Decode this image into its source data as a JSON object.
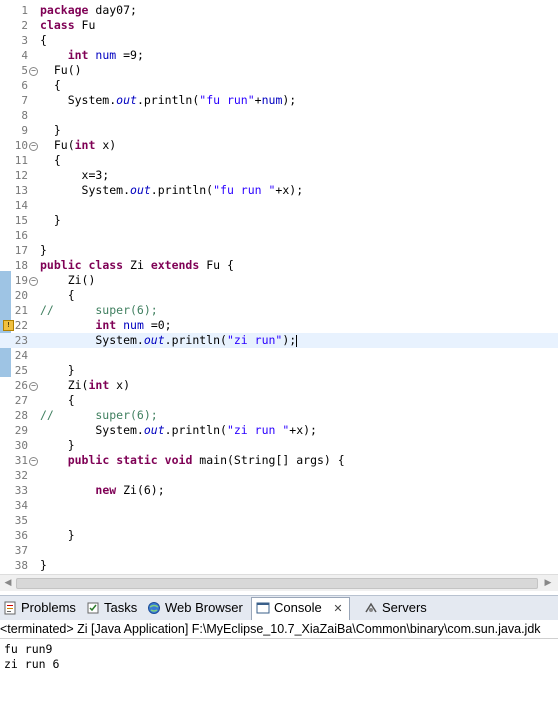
{
  "editor": {
    "current_line": 23,
    "lines": [
      {
        "n": "1",
        "segs": [
          {
            "t": "package",
            "c": "kw"
          },
          {
            "t": " day07;"
          }
        ]
      },
      {
        "n": "2",
        "segs": [
          {
            "t": "class",
            "c": "kw"
          },
          {
            "t": " Fu"
          }
        ]
      },
      {
        "n": "3",
        "segs": [
          {
            "t": "{"
          }
        ]
      },
      {
        "n": "4",
        "segs": [
          {
            "t": "    "
          },
          {
            "t": "int",
            "c": "kw"
          },
          {
            "t": " "
          },
          {
            "t": "num",
            "c": "fld"
          },
          {
            "t": " =9;"
          }
        ]
      },
      {
        "n": "5",
        "fold": true,
        "segs": [
          {
            "t": "  Fu()"
          }
        ]
      },
      {
        "n": "6",
        "segs": [
          {
            "t": "  {"
          }
        ]
      },
      {
        "n": "7",
        "segs": [
          {
            "t": "    System."
          },
          {
            "t": "out",
            "c": "it"
          },
          {
            "t": ".println("
          },
          {
            "t": "\"fu run\"",
            "c": "str"
          },
          {
            "t": "+"
          },
          {
            "t": "num",
            "c": "fld"
          },
          {
            "t": ");"
          }
        ]
      },
      {
        "n": "8",
        "segs": []
      },
      {
        "n": "9",
        "segs": [
          {
            "t": "  }"
          }
        ]
      },
      {
        "n": "10",
        "fold": true,
        "segs": [
          {
            "t": "  Fu("
          },
          {
            "t": "int",
            "c": "kw"
          },
          {
            "t": " x)"
          }
        ]
      },
      {
        "n": "11",
        "segs": [
          {
            "t": "  {"
          }
        ]
      },
      {
        "n": "12",
        "segs": [
          {
            "t": "      x=3;"
          }
        ]
      },
      {
        "n": "13",
        "segs": [
          {
            "t": "      System."
          },
          {
            "t": "out",
            "c": "it"
          },
          {
            "t": ".println("
          },
          {
            "t": "\"fu run \"",
            "c": "str"
          },
          {
            "t": "+x);"
          }
        ]
      },
      {
        "n": "14",
        "segs": []
      },
      {
        "n": "15",
        "segs": [
          {
            "t": "  }"
          }
        ]
      },
      {
        "n": "16",
        "segs": []
      },
      {
        "n": "17",
        "segs": [
          {
            "t": "}"
          }
        ]
      },
      {
        "n": "18",
        "segs": [
          {
            "t": "public",
            "c": "kw"
          },
          {
            "t": " "
          },
          {
            "t": "class",
            "c": "kw"
          },
          {
            "t": " Zi "
          },
          {
            "t": "extends",
            "c": "kw"
          },
          {
            "t": " Fu {"
          }
        ]
      },
      {
        "n": "19",
        "fold": true,
        "segs": [
          {
            "t": "    Zi()"
          }
        ]
      },
      {
        "n": "20",
        "segs": [
          {
            "t": "    {"
          }
        ]
      },
      {
        "n": "21",
        "segs": [
          {
            "t": "//      super(6);",
            "c": "cm"
          }
        ]
      },
      {
        "n": "22",
        "warn": true,
        "segs": [
          {
            "t": "        "
          },
          {
            "t": "int",
            "c": "kw"
          },
          {
            "t": " "
          },
          {
            "t": "num",
            "c": "fld"
          },
          {
            "t": " =0;"
          }
        ]
      },
      {
        "n": "23",
        "caret": true,
        "segs": [
          {
            "t": "        System."
          },
          {
            "t": "out",
            "c": "it"
          },
          {
            "t": ".println("
          },
          {
            "t": "\"zi run\"",
            "c": "str"
          },
          {
            "t": ");"
          }
        ]
      },
      {
        "n": "24",
        "segs": []
      },
      {
        "n": "25",
        "segs": [
          {
            "t": "    }"
          }
        ]
      },
      {
        "n": "26",
        "fold": true,
        "segs": [
          {
            "t": "    Zi("
          },
          {
            "t": "int",
            "c": "kw"
          },
          {
            "t": " x)"
          }
        ]
      },
      {
        "n": "27",
        "segs": [
          {
            "t": "    {"
          }
        ]
      },
      {
        "n": "28",
        "segs": [
          {
            "t": "//      super(6);",
            "c": "cm"
          }
        ]
      },
      {
        "n": "29",
        "segs": [
          {
            "t": "        System."
          },
          {
            "t": "out",
            "c": "it"
          },
          {
            "t": ".println("
          },
          {
            "t": "\"zi run \"",
            "c": "str"
          },
          {
            "t": "+x);"
          }
        ]
      },
      {
        "n": "30",
        "segs": [
          {
            "t": "    }"
          }
        ]
      },
      {
        "n": "31",
        "fold": true,
        "segs": [
          {
            "t": "    "
          },
          {
            "t": "public",
            "c": "kw"
          },
          {
            "t": " "
          },
          {
            "t": "static",
            "c": "kw"
          },
          {
            "t": " "
          },
          {
            "t": "void",
            "c": "kw"
          },
          {
            "t": " main(String[] args) {"
          }
        ]
      },
      {
        "n": "32",
        "segs": []
      },
      {
        "n": "33",
        "segs": [
          {
            "t": "        "
          },
          {
            "t": "new",
            "c": "kw"
          },
          {
            "t": " Zi(6);"
          }
        ]
      },
      {
        "n": "34",
        "segs": []
      },
      {
        "n": "35",
        "segs": []
      },
      {
        "n": "36",
        "segs": [
          {
            "t": "    }"
          }
        ]
      },
      {
        "n": "37",
        "segs": []
      },
      {
        "n": "38",
        "segs": [
          {
            "t": "}"
          }
        ]
      }
    ]
  },
  "tabs": [
    {
      "label": "Problems",
      "icon": "problems-icon",
      "active": false
    },
    {
      "label": "Tasks",
      "icon": "tasks-icon",
      "active": false
    },
    {
      "label": "Web Browser",
      "icon": "globe-icon",
      "active": false
    },
    {
      "label": "Console",
      "icon": "console-icon",
      "active": true,
      "close": "✕"
    },
    {
      "label": "Servers",
      "icon": "servers-icon",
      "active": false
    }
  ],
  "console": {
    "header": "<terminated> Zi [Java Application] F:\\MyEclipse_10.7_XiaZaiBa\\Common\\binary\\com.sun.java.jdk",
    "output": [
      "fu run9",
      "zi run 6"
    ]
  },
  "colors": {
    "keyword": "#7f0055",
    "comment": "#3f7f5f",
    "field": "#0000c0",
    "string": "#2a00ff",
    "current_line": "#e8f2fe"
  }
}
